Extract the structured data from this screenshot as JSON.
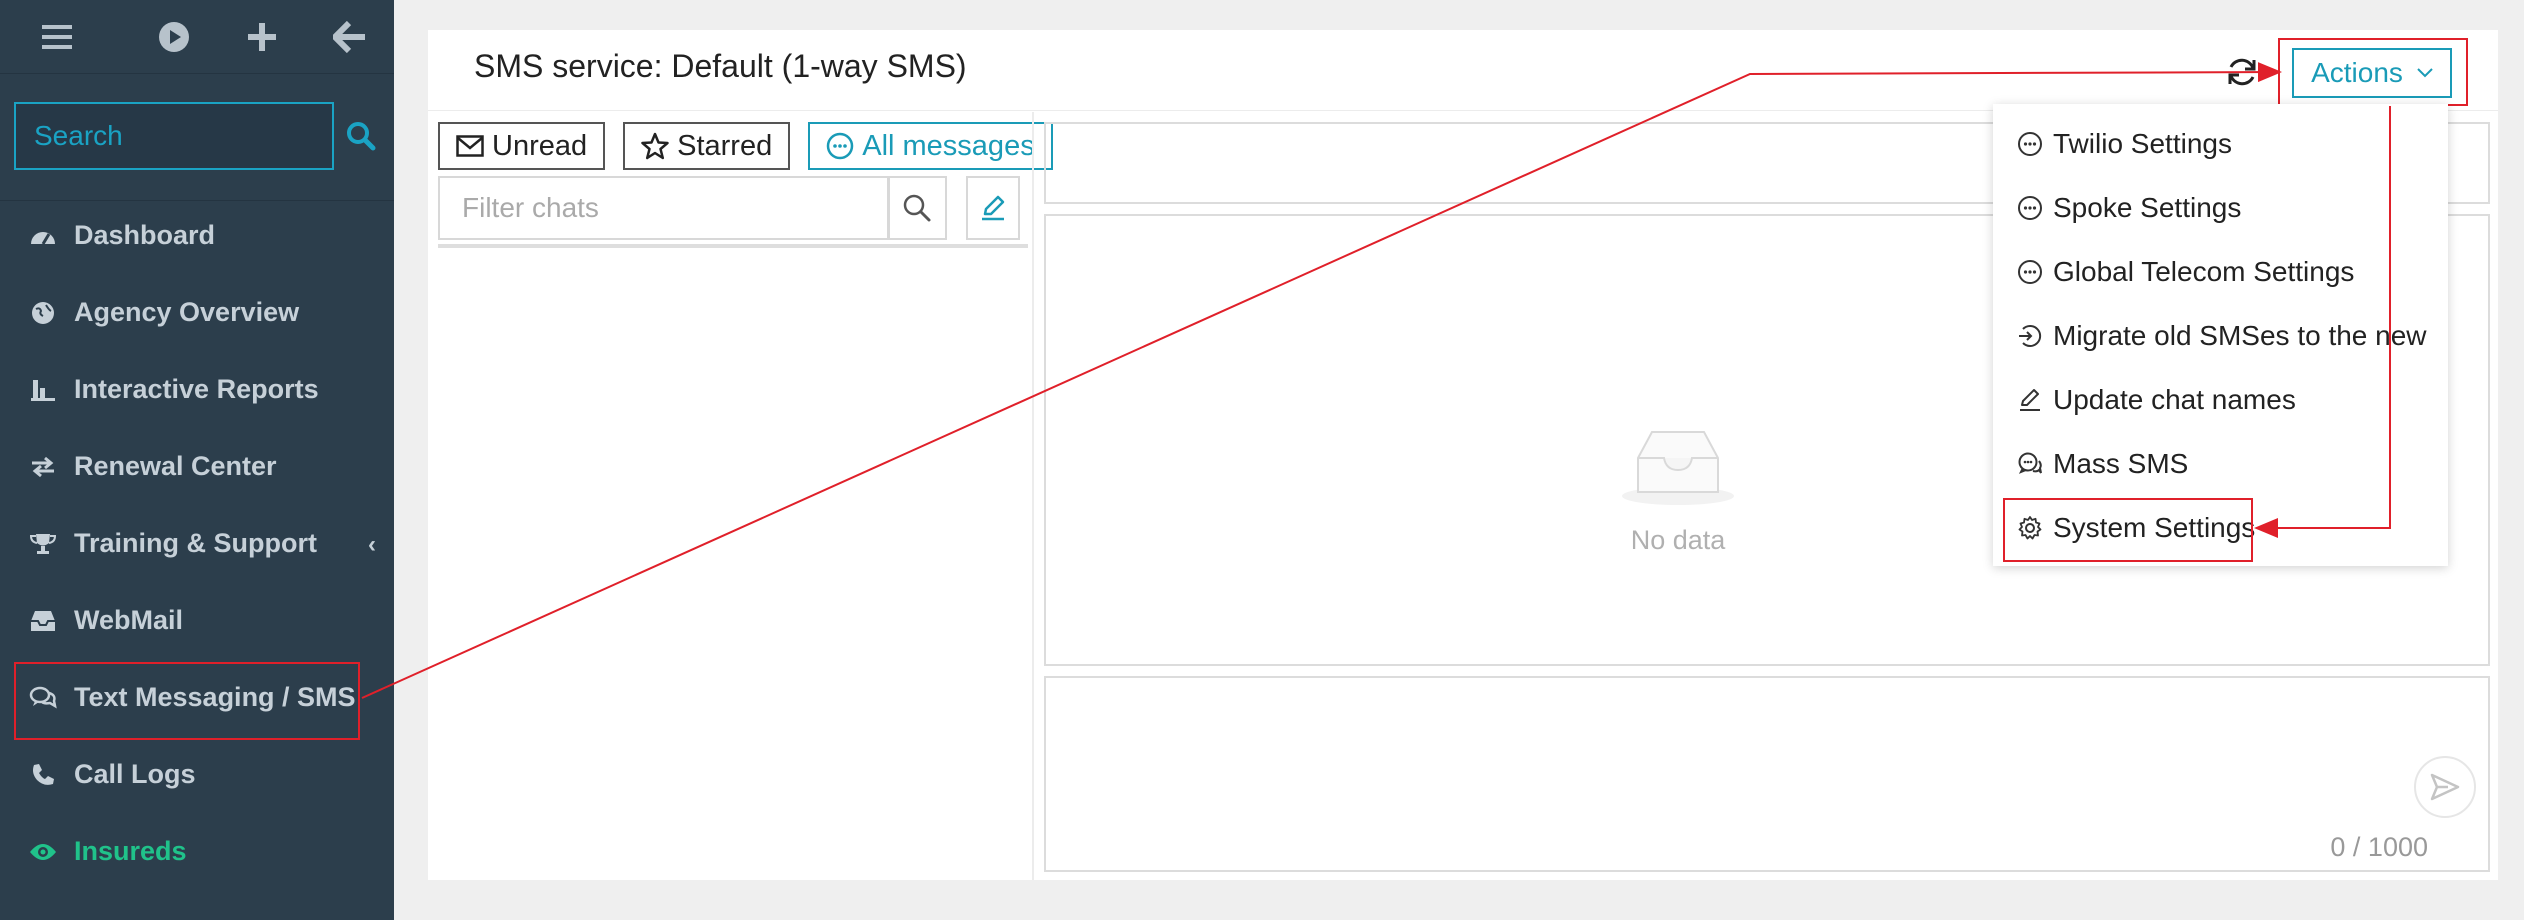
{
  "sidebar": {
    "search_placeholder": "Search",
    "items": [
      {
        "label": "Dashboard",
        "icon": "dashboard-icon"
      },
      {
        "label": "Agency Overview",
        "icon": "globe-icon"
      },
      {
        "label": "Interactive Reports",
        "icon": "bar-chart-icon"
      },
      {
        "label": "Renewal Center",
        "icon": "exchange-icon"
      },
      {
        "label": "Training & Support",
        "icon": "trophy-icon"
      },
      {
        "label": "WebMail",
        "icon": "inbox-icon"
      },
      {
        "label": "Text Messaging / SMS",
        "icon": "chat-icon"
      },
      {
        "label": "Call Logs",
        "icon": "phone-icon"
      },
      {
        "label": "Insureds",
        "icon": "eye-icon"
      }
    ]
  },
  "header": {
    "title": "SMS service: Default (1-way SMS)",
    "actions_label": "Actions"
  },
  "tabs": {
    "unread": "Unread",
    "starred": "Starred",
    "all": "All messages"
  },
  "filter": {
    "placeholder": "Filter chats"
  },
  "messages": {
    "empty_text": "No data",
    "counter": "0 / 1000"
  },
  "actions_menu": [
    {
      "label": "Twilio Settings",
      "icon": "chat-bubble-icon"
    },
    {
      "label": "Spoke Settings",
      "icon": "chat-bubble-icon"
    },
    {
      "label": "Global Telecom Settings",
      "icon": "chat-bubble-icon"
    },
    {
      "label": "Migrate old SMSes to the new",
      "icon": "migrate-icon"
    },
    {
      "label": "Update chat names",
      "icon": "edit-icon"
    },
    {
      "label": "Mass SMS",
      "icon": "comments-icon"
    },
    {
      "label": "System Settings",
      "icon": "gear-icon"
    }
  ],
  "colors": {
    "sidebar_bg": "#2c3e4c",
    "accent": "#1a9bb7",
    "active_green": "#20c28a",
    "annotation_red": "#e0202a"
  }
}
